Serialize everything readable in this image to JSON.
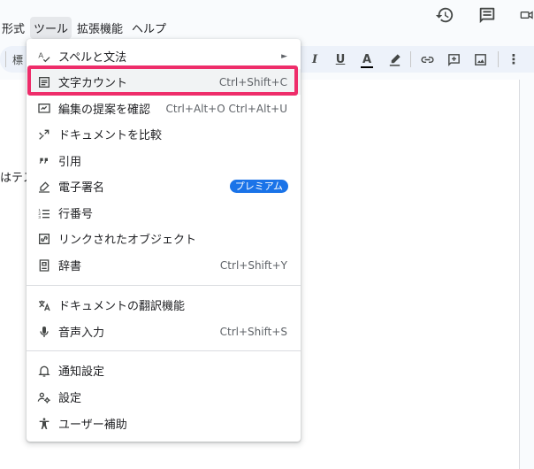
{
  "menubar": {
    "items": [
      "形式",
      "ツール",
      "拡張機能",
      "ヘルプ"
    ],
    "active": "ツール"
  },
  "top_icons": [
    "history-icon",
    "comment-icon",
    "video-call-icon"
  ],
  "toolbar": {
    "left_text": "標",
    "buttons": [
      "italic-icon",
      "underline-icon",
      "text-color-icon",
      "highlight-icon",
      "link-icon",
      "add-comment-icon",
      "insert-image-icon",
      "more-icon"
    ],
    "italic_label": "I",
    "underline_label": "U",
    "text_color_label": "A",
    "more_label": "⋮"
  },
  "document": {
    "text_fragment": "はテス"
  },
  "tools_menu": {
    "items": [
      {
        "icon": "spellcheck-icon",
        "label": "スペルと文法",
        "shortcut": "",
        "submenu": true
      },
      {
        "icon": "word-count-icon",
        "label": "文字カウント",
        "shortcut": "Ctrl+Shift+C",
        "highlighted": true
      },
      {
        "icon": "review-suggestions-icon",
        "label": "編集の提案を確認",
        "shortcut": "Ctrl+Alt+O Ctrl+Alt+U"
      },
      {
        "icon": "compare-documents-icon",
        "label": "ドキュメントを比較",
        "shortcut": ""
      },
      {
        "icon": "citation-icon",
        "label": "引用",
        "shortcut": ""
      },
      {
        "icon": "esignature-icon",
        "label": "電子署名",
        "badge": "プレミアム"
      },
      {
        "icon": "line-numbers-icon",
        "label": "行番号",
        "shortcut": ""
      },
      {
        "icon": "linked-objects-icon",
        "label": "リンクされたオブジェクト",
        "shortcut": ""
      },
      {
        "icon": "dictionary-icon",
        "label": "辞書",
        "shortcut": "Ctrl+Shift+Y"
      },
      {
        "icon": "translate-icon",
        "label": "ドキュメントの翻訳機能",
        "shortcut": ""
      },
      {
        "icon": "microphone-icon",
        "label": "音声入力",
        "shortcut": "Ctrl+Shift+S"
      },
      {
        "icon": "bell-icon",
        "label": "通知設定",
        "shortcut": ""
      },
      {
        "icon": "preferences-icon",
        "label": "設定",
        "shortcut": ""
      },
      {
        "icon": "accessibility-icon",
        "label": "ユーザー補助",
        "shortcut": ""
      }
    ],
    "submenu_arrow": "►"
  },
  "colors": {
    "highlight_border": "#ee2d6a",
    "badge_bg": "#1a73e8",
    "toolbar_bg": "#edf2fa",
    "menu_hover": "#f1f3f4"
  }
}
